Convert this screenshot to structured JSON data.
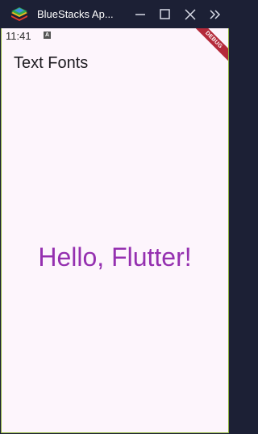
{
  "window": {
    "title": "BlueStacks Ap..."
  },
  "status_bar": {
    "time": "11:41",
    "notification_icon_letter": "A"
  },
  "app": {
    "title": "Text Fonts",
    "body_text": "Hello, Flutter!",
    "debug_banner": "DEBUG"
  },
  "colors": {
    "titlebar_bg": "#1c2035",
    "screen_bg": "#fdf5fc",
    "screen_border": "#8fb43c",
    "body_text": "#9530b0",
    "debug_ribbon": "#b42a3a"
  },
  "icons": {
    "app_logo": "bluestacks-logo-icon",
    "minimize": "minimize-icon",
    "maximize": "maximize-icon",
    "close": "close-icon",
    "more": "double-chevron-right-icon",
    "status": "notification-a-icon"
  }
}
